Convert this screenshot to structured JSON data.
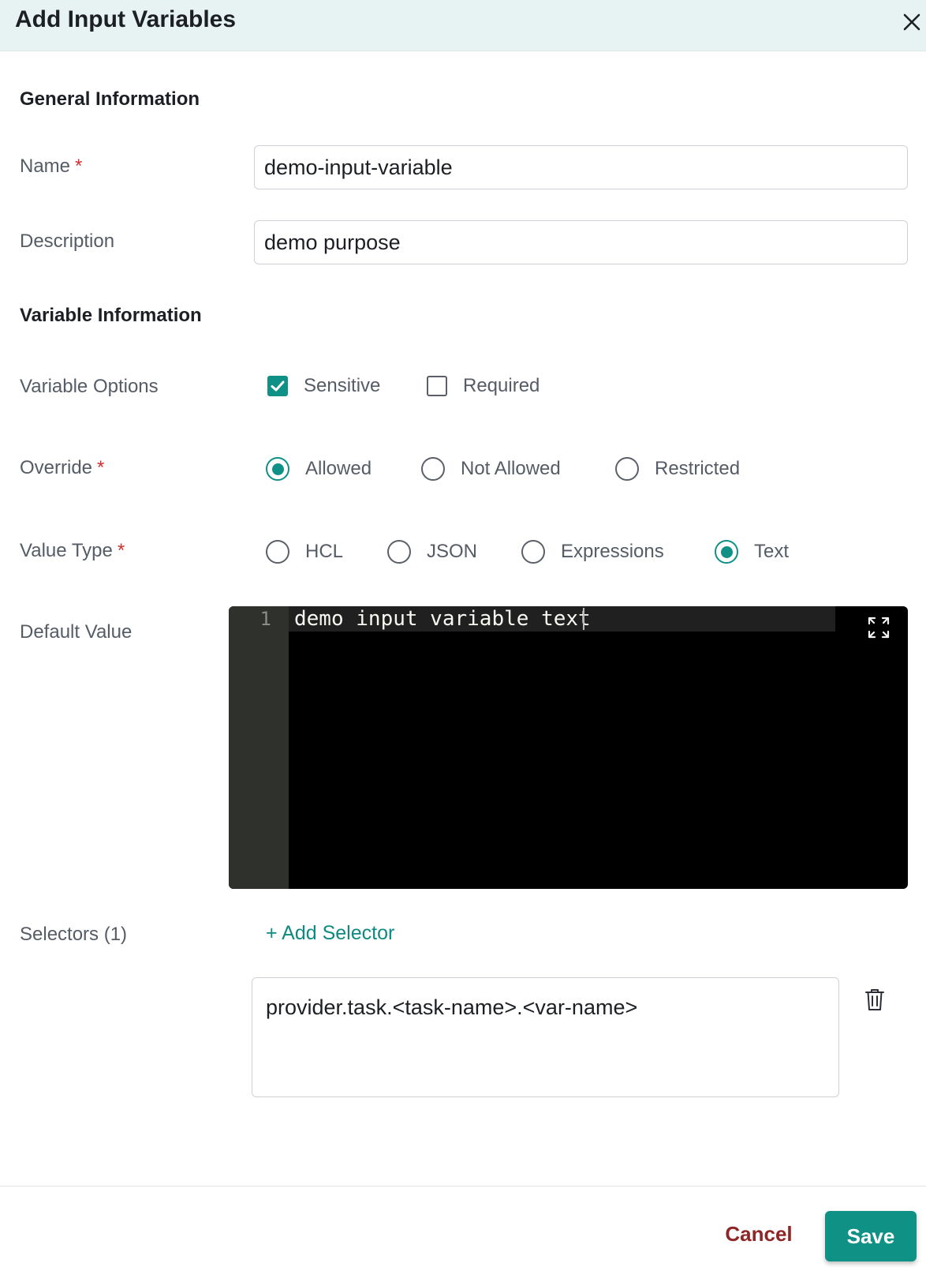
{
  "dialog": {
    "title": "Add Input Variables"
  },
  "general": {
    "title": "General Information",
    "name_label": "Name",
    "name_value": "demo-input-variable",
    "description_label": "Description",
    "description_value": "demo purpose",
    "required_mark": "*"
  },
  "variable": {
    "title": "Variable Information",
    "options_label": "Variable Options",
    "options": [
      {
        "label": "Sensitive",
        "checked": true
      },
      {
        "label": "Required",
        "checked": false
      }
    ],
    "override_label": "Override",
    "override_options": [
      {
        "label": "Allowed",
        "selected": true
      },
      {
        "label": "Not Allowed",
        "selected": false
      },
      {
        "label": "Restricted",
        "selected": false
      }
    ],
    "value_type_label": "Value Type",
    "value_type_options": [
      {
        "label": "HCL",
        "selected": false
      },
      {
        "label": "JSON",
        "selected": false
      },
      {
        "label": "Expressions",
        "selected": false
      },
      {
        "label": "Text",
        "selected": true
      }
    ],
    "default_value_label": "Default Value",
    "editor": {
      "line_number": "1",
      "code": "demo input variable text"
    }
  },
  "selectors": {
    "label": "Selectors (1)",
    "add_label": "+ Add Selector",
    "items": [
      "provider.task.<task-name>.<var-name>"
    ]
  },
  "footer": {
    "cancel_label": "Cancel",
    "save_label": "Save"
  },
  "colors": {
    "accent": "#0f9186",
    "required": "#d32f2f",
    "cancel": "#8f2626",
    "header_bg": "#e6f3f2"
  }
}
